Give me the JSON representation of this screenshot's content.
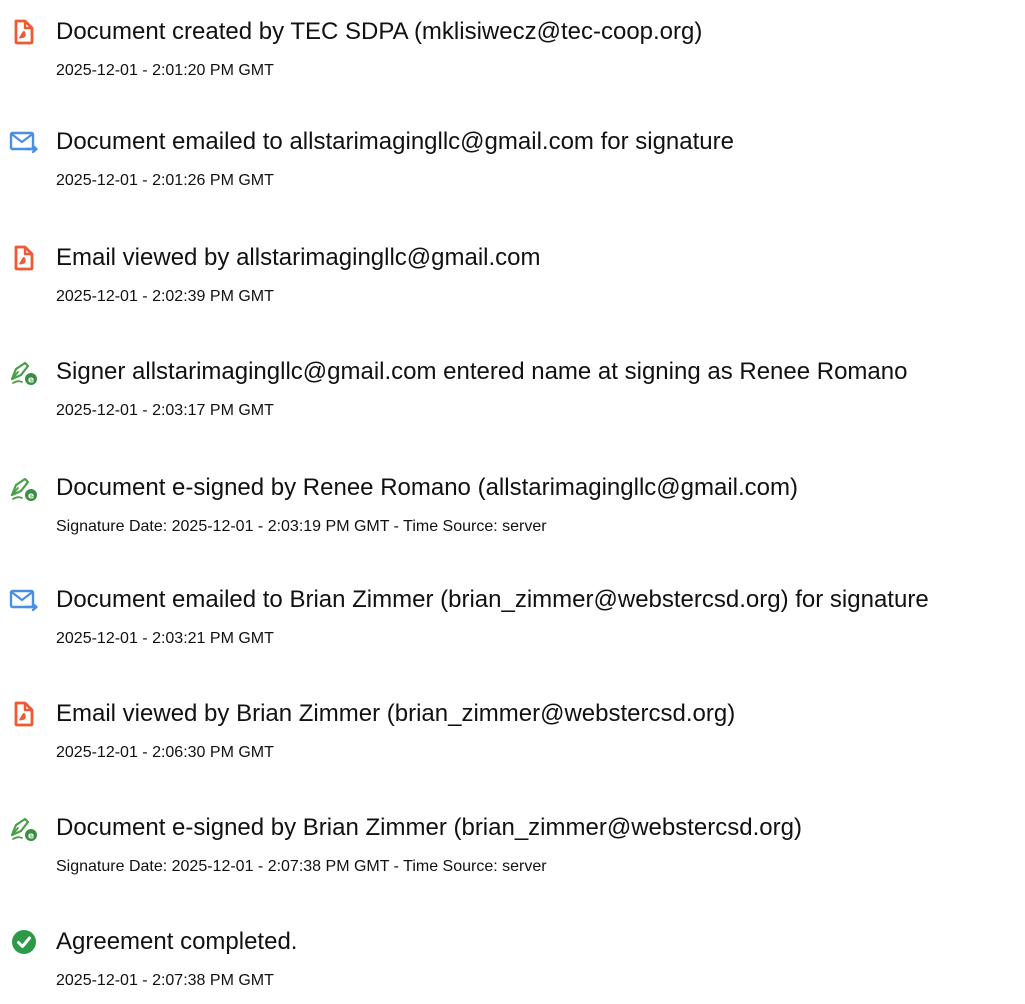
{
  "colors": {
    "document_icon": "#ee5a35",
    "email_icon": "#4a90e2",
    "sign_pen": "#4a9e45",
    "sign_badge": "#3a8f44",
    "completed_icon": "#2e9a48"
  },
  "events": [
    {
      "icon": "document-icon",
      "title": "Document created by TEC SDPA (mklisiwecz@tec-coop.org)",
      "time": "2025-12-01 - 2:01:20 PM GMT"
    },
    {
      "icon": "email-sent-icon",
      "title": "Document emailed to allstarimagingllc@gmail.com for signature",
      "time": "2025-12-01 - 2:01:26 PM GMT"
    },
    {
      "icon": "document-icon",
      "title": "Email viewed by allstarimagingllc@gmail.com",
      "time": "2025-12-01 - 2:02:39 PM GMT"
    },
    {
      "icon": "e-sign-pen-icon",
      "title": "Signer allstarimagingllc@gmail.com entered name at signing as Renee Romano",
      "time": "2025-12-01 - 2:03:17 PM GMT"
    },
    {
      "icon": "e-sign-pen-icon",
      "title": "Document e-signed by Renee Romano (allstarimagingllc@gmail.com)",
      "time": "Signature Date: 2025-12-01 - 2:03:19 PM GMT - Time Source: server"
    },
    {
      "icon": "email-sent-icon",
      "title": "Document emailed to Brian Zimmer (brian_zimmer@webstercsd.org) for signature",
      "time": "2025-12-01 - 2:03:21 PM GMT"
    },
    {
      "icon": "document-icon",
      "title": "Email viewed by Brian Zimmer (brian_zimmer@webstercsd.org)",
      "time": "2025-12-01 - 2:06:30 PM GMT"
    },
    {
      "icon": "e-sign-pen-icon",
      "title": "Document e-signed by Brian Zimmer (brian_zimmer@webstercsd.org)",
      "time": "Signature Date: 2025-12-01 - 2:07:38 PM GMT - Time Source: server"
    },
    {
      "icon": "check-circle-icon",
      "title": "Agreement completed.",
      "time": "2025-12-01 - 2:07:38 PM GMT"
    }
  ]
}
